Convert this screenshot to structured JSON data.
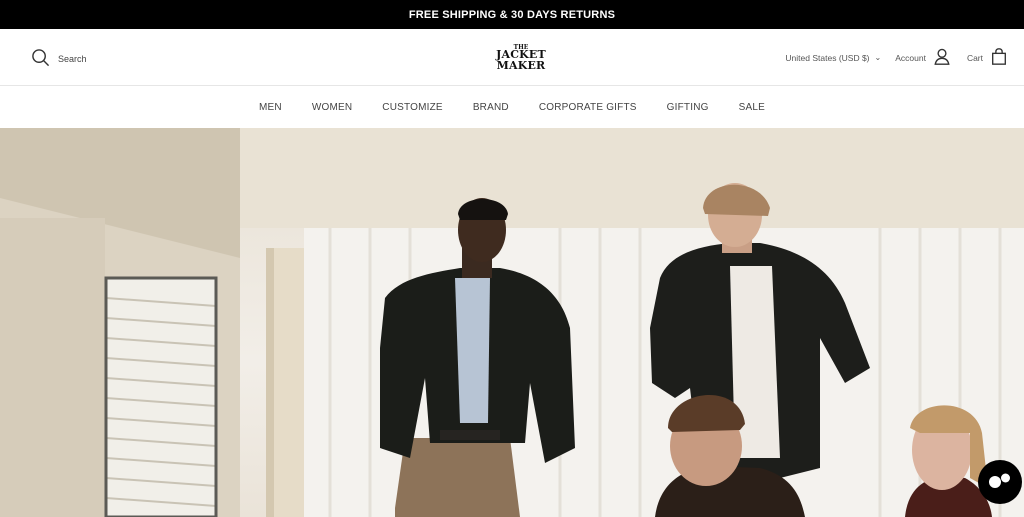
{
  "announcement": {
    "text": "FREE SHIPPING & 30 DAYS RETURNS"
  },
  "header": {
    "search_label": "Search",
    "logo": {
      "line1": "THE",
      "line2": "JACKET",
      "line3": "MAKER"
    },
    "currency_label": "United States (USD $)",
    "account_label": "Account",
    "cart_label": "Cart"
  },
  "nav": {
    "items": [
      {
        "label": "MEN"
      },
      {
        "label": "WOMEN"
      },
      {
        "label": "CUSTOMIZE"
      },
      {
        "label": "BRAND"
      },
      {
        "label": "CORPORATE GIFTS"
      },
      {
        "label": "GIFTING"
      },
      {
        "label": "SALE"
      }
    ]
  },
  "hero": {
    "icon": "hero-photo-men-leather-jackets"
  },
  "chat": {
    "icon": "chat-icon"
  },
  "colors": {
    "announcement_bg": "#000000",
    "chat_bg": "#000000"
  }
}
